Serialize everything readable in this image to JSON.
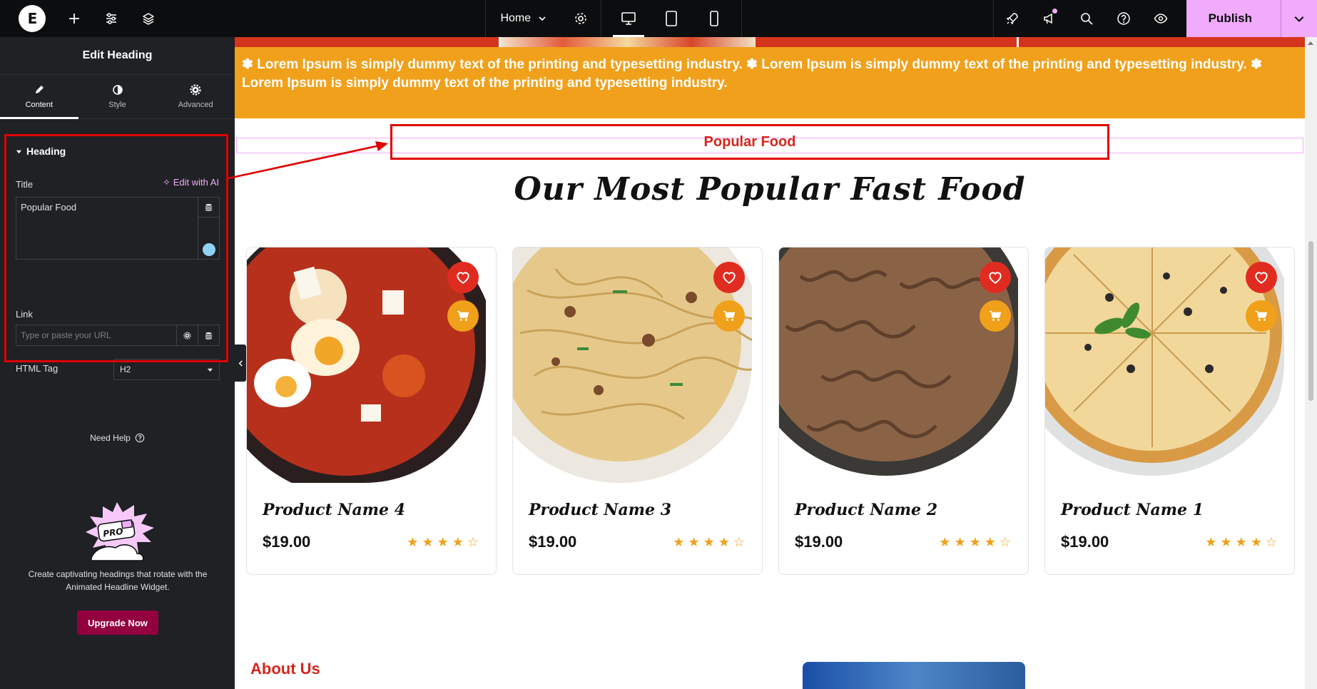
{
  "topbar": {
    "page_name": "Home",
    "publish_label": "Publish",
    "colors": {
      "bg": "#0c0d0e",
      "publish": "#f0abfc"
    },
    "icons": [
      "elementor-logo-icon",
      "add-element-icon",
      "site-settings-icon",
      "structure-layers-icon",
      "page-settings-icon",
      "desktop-icon",
      "tablet-icon",
      "mobile-icon",
      "launchpad-rocket-icon",
      "whats-new-megaphone-icon",
      "search-icon",
      "help-icon",
      "preview-eye-icon",
      "chevron-down-icon"
    ]
  },
  "panel": {
    "title": "Edit Heading",
    "tabs": [
      {
        "label": "Content",
        "icon": "pencil-icon",
        "active": true
      },
      {
        "label": "Style",
        "icon": "half-circle-icon",
        "active": false
      },
      {
        "label": "Advanced",
        "icon": "gear-icon",
        "active": false
      }
    ],
    "section_title": "Heading",
    "title_label": "Title",
    "ai_link": "Edit with AI",
    "title_value": "Popular Food",
    "link_label": "Link",
    "link_placeholder": "Type or paste your URL",
    "html_tag_label": "HTML Tag",
    "html_tag_value": "H2",
    "need_help": "Need Help",
    "promo_text": "Create captivating headings that rotate with the Animated Headline Widget.",
    "upgrade_label": "Upgrade Now",
    "pro_badge": "PRO"
  },
  "canvas": {
    "marquee_text": "✽ Lorem Ipsum is simply dummy text of the printing and typesetting industry.   ✽   Lorem Ipsum is simply dummy text of the printing and typesetting industry. ✽ Lorem Ipsum is simply dummy text of the printing and typesetting industry.",
    "popular_food": "Popular Food",
    "main_heading": "Our Most Popular Fast Food",
    "products": [
      {
        "name": "Product Name 4",
        "price": "$19.00",
        "rating": 4.5,
        "food": "shakshuka"
      },
      {
        "name": "Product Name 3",
        "price": "$19.00",
        "rating": 4.5,
        "food": "noodles"
      },
      {
        "name": "Product Name 2",
        "price": "$19.00",
        "rating": 4.5,
        "food": "fusilli"
      },
      {
        "name": "Product Name 1",
        "price": "$19.00",
        "rating": 4.5,
        "food": "pizza"
      }
    ],
    "about_title": "About Us",
    "colors": {
      "accent_red": "#d5261c",
      "accent_orange": "#f0a01a"
    }
  }
}
